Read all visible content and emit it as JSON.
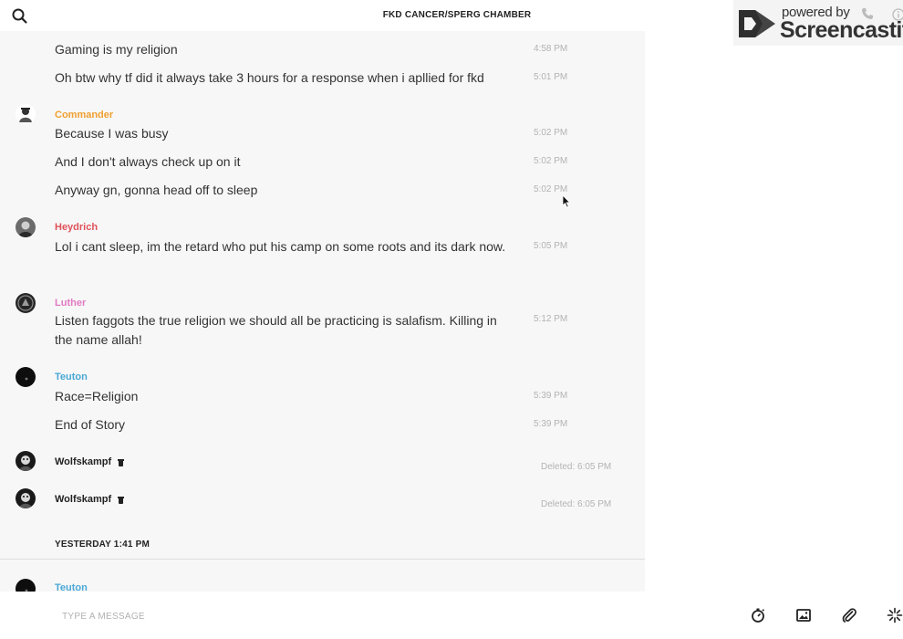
{
  "header": {
    "title": "FKD CANCER/SPERG CHAMBER",
    "search_icon": "search-icon"
  },
  "watermark": {
    "powered": "powered by",
    "brand": "Screencastify",
    "phone_icon": "phone-icon",
    "info_icon": "info-icon"
  },
  "messages": [
    {
      "text": "Gaming is my religion",
      "time": "4:58 PM"
    },
    {
      "text": "Oh btw why tf did it always take 3 hours for a response when i apllied for fkd",
      "time": "5:01 PM"
    },
    {
      "author": "Commander",
      "author_color": "#f0a030"
    },
    {
      "text": "Because I was busy",
      "time": "5:02 PM"
    },
    {
      "text": "And I don't always check up on it",
      "time": "5:02 PM"
    },
    {
      "text": "Anyway gn, gonna head off to sleep",
      "time": "5:02 PM"
    },
    {
      "author": "Heydrich",
      "author_color": "#e0525a"
    },
    {
      "text": "Lol i cant sleep, im the retard who put his camp on some roots and its dark now.",
      "time": "5:05 PM"
    },
    {
      "author": "Luther",
      "author_color": "#e27ac4"
    },
    {
      "text": "Listen faggots the true religion we should all be practicing is salafism. Killing in the name allah!",
      "time": "5:12 PM"
    },
    {
      "author": "Teuton",
      "author_color": "#4aa8d6"
    },
    {
      "text": "Race=Religion",
      "time": "5:39 PM"
    },
    {
      "text": "End of Story",
      "time": "5:39 PM"
    },
    {
      "author": "Wolfskampf",
      "author_color": "#222222",
      "status": "Deleted: 6:05 PM"
    },
    {
      "author": "Wolfskampf",
      "author_color": "#222222",
      "status": "Deleted: 6:05 PM"
    },
    {
      "day_label": "YESTERDAY 1:41 PM"
    },
    {
      "author": "Teuton",
      "author_color": "#4aa8d6"
    }
  ],
  "composer": {
    "placeholder": "TYPE A MESSAGE",
    "tools": [
      "timer-icon",
      "image-icon",
      "paperclip-icon",
      "sparkle-icon"
    ]
  }
}
